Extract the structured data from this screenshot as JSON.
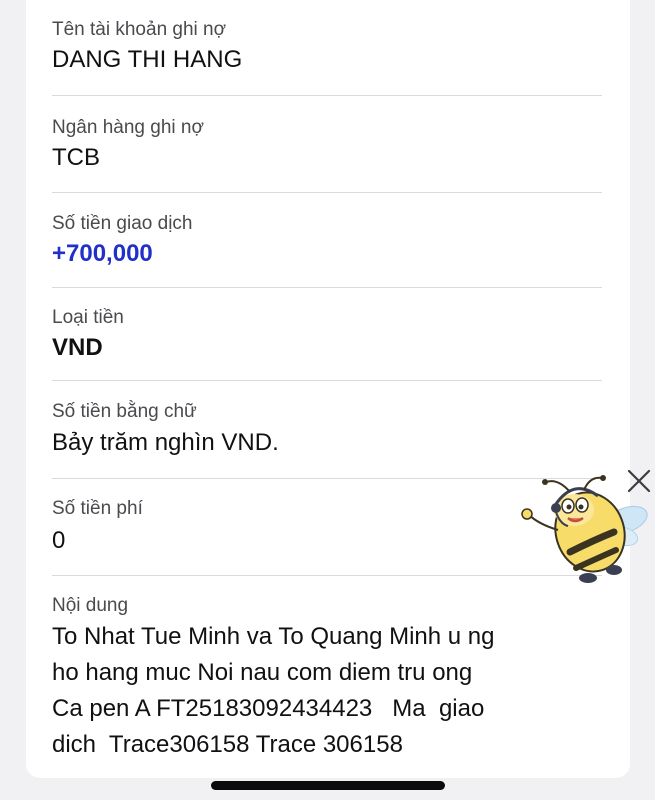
{
  "fields": [
    {
      "label": "Tên tài khoản ghi nợ",
      "value": "DANG THI HANG"
    },
    {
      "label": "Ngân hàng ghi nợ",
      "value": "TCB"
    },
    {
      "label": "Số tiền giao dịch",
      "value": "+700,000"
    },
    {
      "label": "Loại tiền",
      "value": "VND"
    },
    {
      "label": "Số tiền bằng chữ",
      "value": "Bảy trăm nghìn VND."
    },
    {
      "label": "Số tiền phí",
      "value": "0"
    },
    {
      "label": "Nội dung",
      "value": "To Nhat Tue Minh va To Quang Minh u ng\nho hang muc Noi nau com diem tru ong\nCa pen A FT25183092434423   Ma  giao\ndich  Trace306158 Trace 306158"
    }
  ],
  "colors": {
    "amount": "#2030c8",
    "text": "#111114",
    "label": "#4a4a4f",
    "background": "#f1f1f4"
  },
  "icons": {
    "close": "close-icon",
    "mascot": "bee-mascot-icon"
  }
}
